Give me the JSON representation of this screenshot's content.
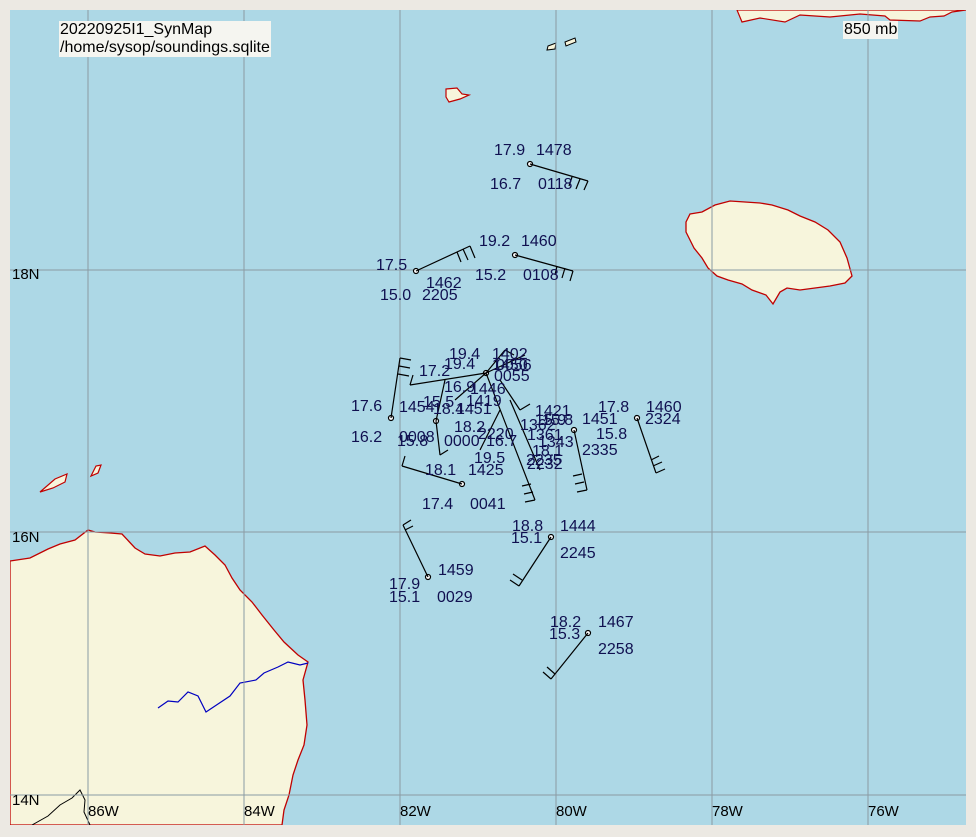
{
  "header": {
    "title": "20220925I1_SynMap",
    "database": "/home/sysop/soundings.sqlite",
    "level": "850 mb"
  },
  "axes": {
    "lat_labels": [
      "18N",
      "16N",
      "14N"
    ],
    "lon_labels": [
      "86W",
      "84W",
      "82W",
      "80W",
      "78W",
      "76W"
    ]
  },
  "colors": {
    "ocean": "#add8e6",
    "land": "#f7f5dc",
    "coast": "#c00000",
    "river": "#0000c0",
    "grid": "#8a9aa3",
    "station_text": "#101050"
  },
  "stations": [
    {
      "t": "17.9",
      "td": "16.7",
      "hgt": "1478",
      "time": "0118"
    },
    {
      "t": "19.2",
      "td": "15.2",
      "hgt": "1460",
      "time": "0108"
    },
    {
      "t": "17.5",
      "td": "15.0",
      "hgt": "1462",
      "time": "2205"
    },
    {
      "t": "17.6",
      "td": "16.2",
      "hgt": "1454",
      "time": "0008"
    },
    {
      "t": "17.8",
      "td": "15.8",
      "hgt": "1460",
      "time": "2324"
    },
    {
      "t": "18.1",
      "td": "17.4",
      "hgt": "1425",
      "time": "0041"
    },
    {
      "t": "18.8",
      "td": "15.1",
      "hgt": "1444",
      "time": "2245"
    },
    {
      "t": "17.9",
      "td": "15.1",
      "hgt": "1459",
      "time": "0029"
    },
    {
      "t": "18.2",
      "td": "15.3",
      "hgt": "1467",
      "time": "2258"
    }
  ],
  "cluster_labels": [
    "19.4",
    "1402",
    "19.4",
    "17.2",
    "1450",
    "16.9",
    "1446",
    "15.5",
    "1419",
    "1451",
    "1421",
    "15.9",
    "18.2",
    "1361",
    "1343",
    "18.1",
    "19.5",
    "2232",
    "0000",
    "16.7",
    "0055",
    "2335",
    "1451",
    "18.4",
    "15.8",
    "1362",
    "2220",
    "15.8",
    "2235",
    "0056"
  ]
}
